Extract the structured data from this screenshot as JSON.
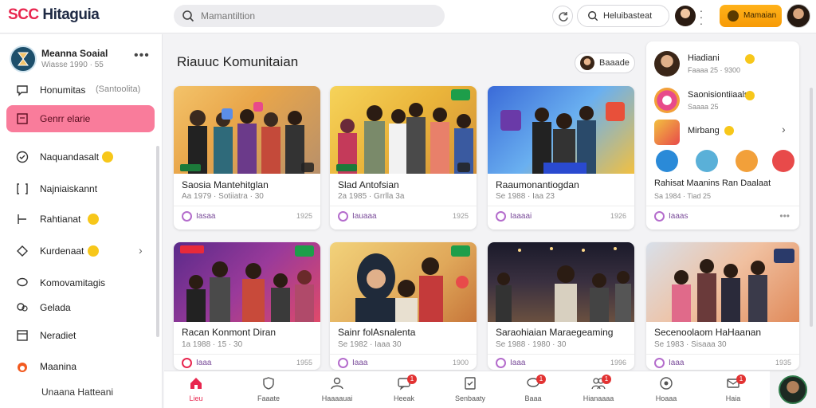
{
  "app": {
    "logo_part1": "SCC",
    "logo_part2": "Hitaguia"
  },
  "header": {
    "search_placeholder": "Mamantiltion",
    "search_button_label": "Heluibasteat",
    "cta_label": "Mamaian"
  },
  "user": {
    "name": "Meanna Soaial",
    "meta": "Wiasse 1990 · 55",
    "more": "•••"
  },
  "sidebar": {
    "items": [
      {
        "label": "Honumitas",
        "sub": "(Santoolita)",
        "icon": "heart-chat-icon"
      },
      {
        "label": "Genrr elarie",
        "icon": "message-square-icon",
        "active": true
      },
      {
        "label": "Naquandasalt",
        "icon": "check-circle-icon",
        "badge": true
      },
      {
        "label": "Najniaiskannt",
        "icon": "bracket-icon"
      },
      {
        "label": "Rahtianat",
        "icon": "grid-icon",
        "badge": true
      },
      {
        "label": "Kurdenaat",
        "icon": "diamond-icon",
        "badge": true,
        "chevron": "›"
      },
      {
        "label": "Komovamitagis",
        "icon": "chat-bubble-icon"
      },
      {
        "label": "Gelada",
        "icon": "chat-bubbles-icon"
      },
      {
        "label": "Neradiet",
        "icon": "note-icon"
      },
      {
        "label": "Maanina",
        "icon": "fire-icon"
      }
    ],
    "footer": "Unaana Hatteani"
  },
  "main": {
    "title": "Riauuc Komunitaian",
    "button_label": "Baaade",
    "cards": [
      {
        "title": "Saosia Mantehitglan",
        "meta": "Aa 1979 · Sotiiatra · 30",
        "footer": "Iasaa",
        "right": "1925"
      },
      {
        "title": "Slad Antofsian",
        "meta": "2a 1985 · Grrlla 3a",
        "footer": "Iauaaa",
        "right": "1925"
      },
      {
        "title": "Raaumonantiogdan",
        "meta": "Se 1988 · Iaa 23",
        "footer": "Iaaaai",
        "right": "1926"
      },
      {
        "title": "Racan Konmont Diran",
        "meta": "1a 1988 · 15 · 30",
        "footer": "Iaaa",
        "right": "1955"
      },
      {
        "title": "Sainr folAsnalenta",
        "meta": "Se 1982 · Iaaa 30",
        "footer": "Iaaa",
        "right": "1900"
      },
      {
        "title": "Saraohiaian Maraegeaming",
        "meta": "Se 1988 · 1980 · 30",
        "footer": "Iaaa",
        "right": "1996"
      },
      {
        "title": "Secenoolaom HaHaanan",
        "meta": "Se 1983 · Sisaaa 30",
        "footer": "Iaaa",
        "right": "1935"
      }
    ]
  },
  "right_panel": {
    "items": [
      {
        "name": "Hiadiani",
        "meta": "Faaaa 25 · 9300"
      },
      {
        "name": "Saonisiontiiaals",
        "meta": "Saaaa 25"
      },
      {
        "name": "Mirbang",
        "meta": ""
      }
    ],
    "chevron": "›",
    "card_title": "Rahisat Maanins Ran Daalaat",
    "card_meta": "Sa 1984 · Tiad 25",
    "footer": "Iaaas",
    "footer_right": "•••"
  },
  "bottom_nav": [
    {
      "label": "Lieu",
      "icon": "home-icon",
      "active": true
    },
    {
      "label": "Faaate",
      "icon": "shield-icon"
    },
    {
      "label": "Haaaauai",
      "icon": "person-icon"
    },
    {
      "label": "Heeak",
      "icon": "chat-icon",
      "badge": "1"
    },
    {
      "label": "Senbaaty",
      "icon": "check-doc-icon"
    },
    {
      "label": "Baaa",
      "icon": "message-icon",
      "badge": "1"
    },
    {
      "label": "Hianaaaa",
      "icon": "group-icon",
      "badge": "1"
    },
    {
      "label": "Hoaaa",
      "icon": "eye-icon"
    },
    {
      "label": "Haia",
      "icon": "mail-icon",
      "badge": "1"
    }
  ],
  "colors": {
    "accent": "#e8264f",
    "active_nav": "#f97c9b",
    "cta": "#f79a06"
  }
}
